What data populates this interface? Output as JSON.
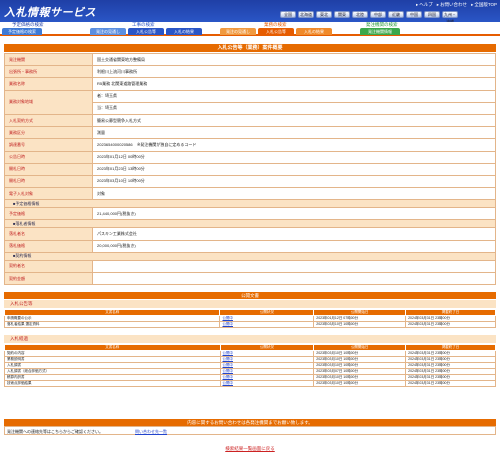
{
  "header": {
    "logo": "入札情報サービス",
    "links": [
      "ヘルプ",
      "お問い合わせ",
      "全国版TOP"
    ],
    "regions": [
      "全国",
      "北海道",
      "東北",
      "関東",
      "北陸",
      "中部",
      "近畿",
      "中国",
      "四国",
      "九州・沖縄"
    ]
  },
  "nav": {
    "groups": [
      {
        "title": "工事の検索",
        "tabs": [
          "発注の見通し",
          "入札公告等",
          "入札の結果"
        ]
      },
      {
        "title": "業務の検索",
        "tabs": [
          "発注の見通し",
          "入札公告等",
          "入札の結果"
        ]
      },
      {
        "title": "発注機関の検索",
        "tabs": [
          "発注機関情報"
        ]
      }
    ],
    "left_title": "予定価格の検索",
    "left_tab": "予定価格の検索",
    "active_tab": "入札公告等"
  },
  "detail": {
    "title": "入札公告等（業務）案件概要",
    "rows": [
      {
        "label": "発注機関",
        "value": "国土交通省関東地方整備局"
      },
      {
        "label": "出張所・事務所",
        "value": "利根川上流河川事務所"
      },
      {
        "label": "業務名称",
        "value": "R5業務 北関東道路管理業務"
      },
      {
        "label": "業務対象地域",
        "value": "者：埼玉県",
        "value2": "当：埼玉県"
      },
      {
        "label": "入札契約方式",
        "value": "簡易公募型競争入札方式"
      },
      {
        "label": "業務区分",
        "value": "測量"
      },
      {
        "label": "調達番号",
        "value": "2023654000020586",
        "note": "※発注機関が独自に定めるコード"
      },
      {
        "label": "公告日時",
        "value": "2023年01月12日 00時00分"
      },
      {
        "label": "開札日時",
        "value": "2023年01月23日 13時00分"
      },
      {
        "label": "開札日時",
        "value": "2023年03月10日 10時00分"
      },
      {
        "label": "電子入札対象",
        "value": "対象"
      }
    ],
    "section_price": "■予定価格情報",
    "price_label": "予定価格",
    "price_value": "21,440,000円(税抜き)",
    "section_bid": "■落札者情報",
    "winner_label": "落札者名",
    "winner_value": "パスキン工業株式会社",
    "amount_label": "落札価格",
    "amount_value": "20,000,000円(税抜き)",
    "section_contract": "■契約情報",
    "contract_labels": [
      "契約者名",
      "契約金額"
    ]
  },
  "public_docs": {
    "title": "公開文書",
    "notice_head": "入札公告等",
    "columns": [
      "文書名称",
      "公開状況",
      "公開開始日",
      "掲載終了日"
    ],
    "notice_rows": [
      [
        "申請概要の公示",
        "公開中",
        "2023年01月12日 07時00分",
        "2024年03月31日 23時00分"
      ],
      [
        "落札者結果 選定資料",
        "公開中",
        "2023年03月10日 10時00分",
        "2024年03月31日 23時00分"
      ]
    ],
    "result_head": "入札経過",
    "result_rows": [
      [
        "契約の内容",
        "公開中",
        "2023年03月10日 10時00分",
        "2024年03月31日 23時00分"
      ],
      [
        "業務説明書",
        "公開中",
        "2023年03月10日 10時00分",
        "2024年03月31日 23時00分"
      ],
      [
        "入札調書",
        "公開中",
        "2023年03月10日 10時00分",
        "2024年03月31日 23時00分"
      ],
      [
        "入札調書（総合評価方式）",
        "公開中",
        "2023年03月07日 10時00分",
        "2024年03月31日 23時00分"
      ],
      [
        "積算内訳書",
        "公開中",
        "2023年03月10日 10時00分",
        "2024年03月31日 23時00分"
      ],
      [
        "技術点評価結果",
        "公開中",
        "2023年03月10日 10時00分",
        "2024年03月31日 23時00分"
      ]
    ]
  },
  "inquiry": {
    "title": "内容に関するお問い合わせは各発注機関までお願い致します。",
    "text": "発注機関への連絡先等はこちらからご確認ください。",
    "link": "問い合わせ先一覧"
  },
  "back_link": "検索結果一覧画面に戻る",
  "colors": {
    "header_blue": "#2a56c6",
    "accent_orange": "#e66b00",
    "label_bg": "#fbe3c4",
    "link": "#2244cc"
  }
}
